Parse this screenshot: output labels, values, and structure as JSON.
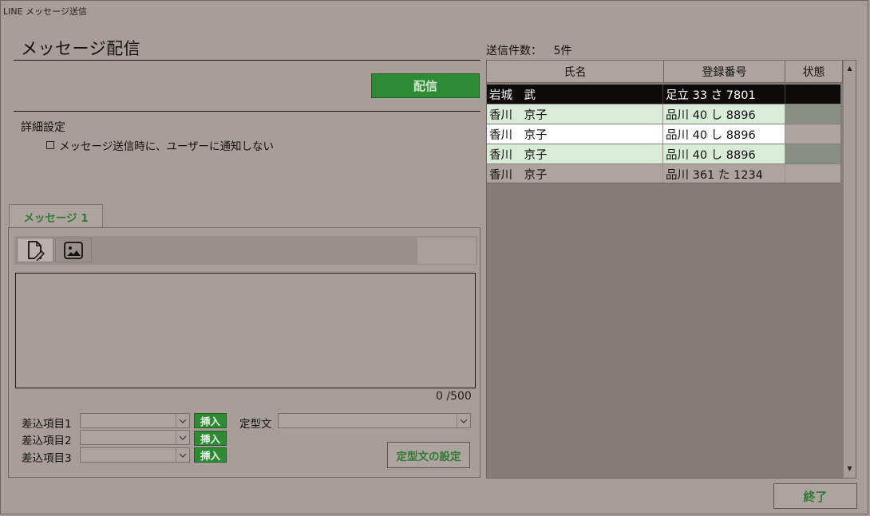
{
  "window": {
    "title": "LINE メッセージ送信"
  },
  "page": {
    "title": "メッセージ配信"
  },
  "actions": {
    "send_label": "配信",
    "close_label": "終了",
    "template_settings_label": "定型文の設定"
  },
  "details": {
    "label": "詳細設定",
    "silent_checkbox_label": "メッセージ送信時に、ユーザーに通知しない",
    "silent_checked": false
  },
  "tabs": [
    {
      "label": "メッセージ 1",
      "active": true
    }
  ],
  "editor": {
    "toolbar": [
      {
        "icon": "document-edit-icon",
        "active": true
      },
      {
        "icon": "image-icon",
        "active": false
      }
    ],
    "text": "",
    "char_count": "0 /500"
  },
  "inserts": [
    {
      "label": "差込項目1",
      "value": "",
      "button": "挿入"
    },
    {
      "label": "差込項目2",
      "value": "",
      "button": "挿入"
    },
    {
      "label": "差込項目3",
      "value": "",
      "button": "挿入"
    }
  ],
  "template": {
    "label": "定型文",
    "value": ""
  },
  "recipients": {
    "count_label": "送信件数：",
    "count_value": "5件",
    "columns": [
      "氏名",
      "登録番号",
      "状態"
    ],
    "rows": [
      {
        "name": "岩城　武",
        "reg": "足立 33 さ 7801",
        "status": ""
      },
      {
        "name": "香川　京子",
        "reg": "品川 40 し 8896",
        "status": ""
      },
      {
        "name": "香川　京子",
        "reg": "品川 40 し 8896",
        "status": ""
      },
      {
        "name": "香川　京子",
        "reg": "品川 40 し 8896",
        "status": ""
      },
      {
        "name": "香川　京子",
        "reg": "品川 361 た 1234",
        "status": ""
      }
    ]
  },
  "colors": {
    "accent": "#2f8a36",
    "selected_row": "#0d0a0a",
    "alt_row": "#d8ecd8",
    "white_row": "#ffffff"
  }
}
